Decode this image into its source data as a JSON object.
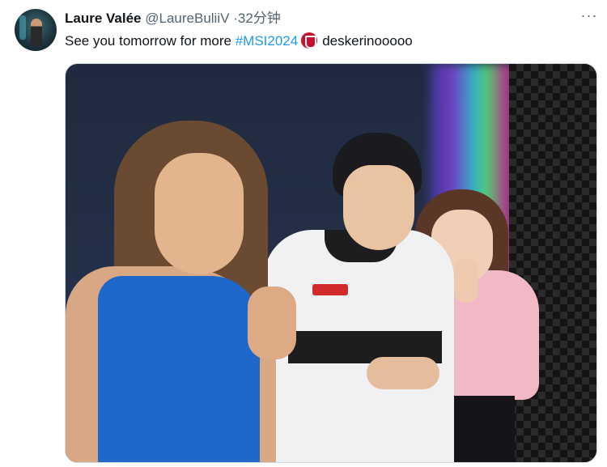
{
  "tweet": {
    "author_name": "Laure Valée",
    "author_handle": "@LaureBuliiV",
    "separator": "·",
    "timestamp": "32分钟",
    "text_before": "See you tomorrow for more ",
    "hashtag": "#MSI2024",
    "text_after": "deskerinooooo",
    "more_label": "···"
  },
  "icons": {
    "more": "more-options-icon",
    "hashtag_emoji": "msi-logo-icon"
  },
  "colors": {
    "hashtag": "#1d9bf0",
    "secondary_text": "#536471",
    "msi_logo": "#c8102e"
  }
}
